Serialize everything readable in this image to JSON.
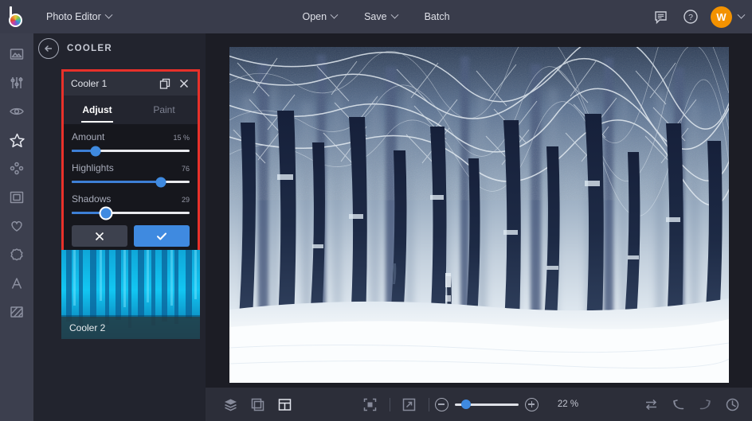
{
  "topbar": {
    "logo_icon": "brand-color-wheel-logo",
    "app_title": "Photo Editor",
    "app_title_caret": "chevron-down-icon",
    "open_label": "Open",
    "save_label": "Save",
    "batch_label": "Batch",
    "feedback_icon": "chat-bubble-icon",
    "help_icon": "question-circle-icon",
    "avatar_initial": "W",
    "avatar_caret": "chevron-down-icon",
    "background": "#393c4b",
    "avatar_color": "#f39200"
  },
  "rail": {
    "items": [
      {
        "name": "photo-icon",
        "active": false
      },
      {
        "name": "adjust-icon",
        "active": false
      },
      {
        "name": "eye-icon",
        "active": false
      },
      {
        "name": "star-icon",
        "active": true
      },
      {
        "name": "particles-icon",
        "active": false
      },
      {
        "name": "frame-icon",
        "active": false
      },
      {
        "name": "heart-icon",
        "active": false
      },
      {
        "name": "badge-icon",
        "active": false
      },
      {
        "name": "text-icon",
        "active": false
      },
      {
        "name": "texture-icon",
        "active": false
      }
    ]
  },
  "panel": {
    "back_icon": "back-arrow-circle-icon",
    "title": "COOLER",
    "highlight_color": "#e8312a",
    "card": {
      "name": "Cooler 1",
      "duplicate_icon": "duplicate-layers-icon",
      "close_icon": "close-x-icon",
      "tabs": [
        {
          "label": "Adjust",
          "active": true
        },
        {
          "label": "Paint",
          "active": false
        }
      ],
      "sliders": [
        {
          "label": "Amount",
          "value": "15 %",
          "percent": 20,
          "focused": false
        },
        {
          "label": "Highlights",
          "value": "76",
          "percent": 76,
          "focused": false
        },
        {
          "label": "Shadows",
          "value": "29",
          "percent": 29,
          "focused": true
        }
      ],
      "cancel_icon": "close-x-icon",
      "apply_icon": "checkmark-icon",
      "accent_color": "#3f8ae0"
    },
    "thumbnail": {
      "label": "Cooler 2",
      "icon": "preset-thumbnail"
    }
  },
  "bottombar": {
    "left_tools": [
      {
        "name": "layers-icon",
        "active": false
      },
      {
        "name": "crop-transform-icon",
        "active": false
      },
      {
        "name": "panel-layout-icon",
        "active": true
      }
    ],
    "view_tools": [
      {
        "name": "fit-to-screen-icon",
        "active": false
      },
      {
        "name": "fullscreen-expand-icon",
        "active": false
      }
    ],
    "zoom_out_icon": "minus-circle-icon",
    "zoom_in_icon": "plus-circle-icon",
    "zoom_percent": 18,
    "zoom_label": "22 %",
    "right_tools": [
      {
        "name": "compare-swap-icon",
        "active": false,
        "dim": false
      },
      {
        "name": "undo-icon",
        "active": false,
        "dim": false
      },
      {
        "name": "redo-icon",
        "active": false,
        "dim": true
      },
      {
        "name": "history-clock-icon",
        "active": false,
        "dim": false
      }
    ]
  },
  "canvas": {
    "image_name": "snowy-winter-forest-photo"
  }
}
